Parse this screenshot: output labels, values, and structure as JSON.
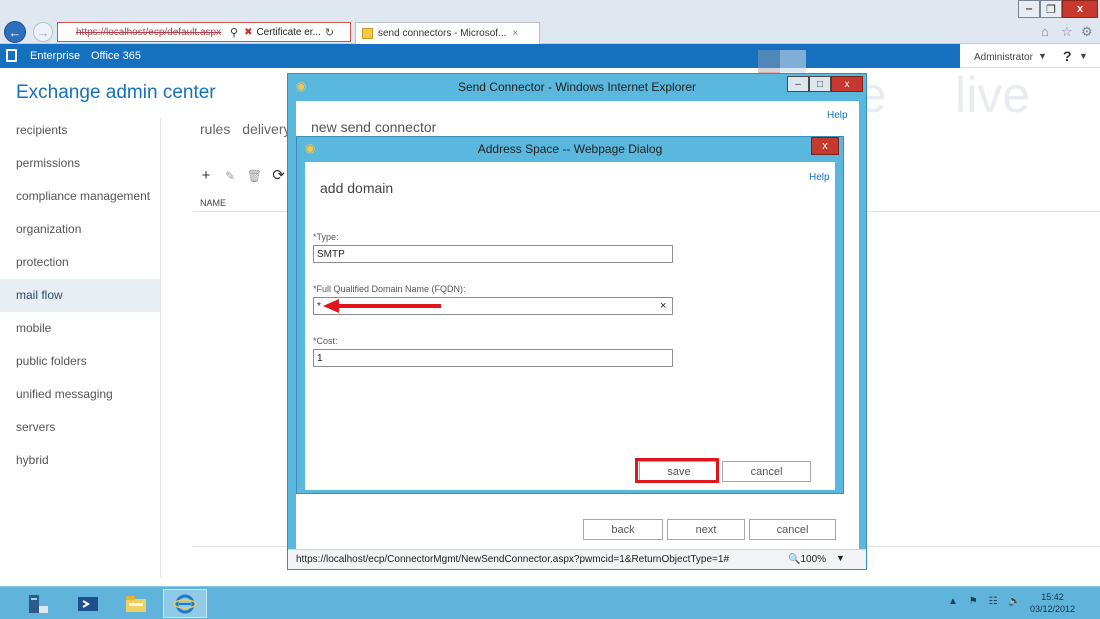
{
  "browser": {
    "address_url": "https://localhost/ecp/default.aspx",
    "cert_error": "Certificate er...",
    "tab_title": "send connectors - Microsof...",
    "tab_close": "×"
  },
  "topbar": {
    "nav_enterprise": "Enterprise",
    "nav_office365": "Office 365",
    "admin_name": "Administrator",
    "admin_caret": "▼",
    "help": "?",
    "help_caret": "▼"
  },
  "app_title": "Exchange admin center",
  "sidebar": {
    "items": [
      {
        "label": "recipients"
      },
      {
        "label": "permissions"
      },
      {
        "label": "compliance management"
      },
      {
        "label": "organization"
      },
      {
        "label": "protection"
      },
      {
        "label": "mail flow"
      },
      {
        "label": "mobile"
      },
      {
        "label": "public folders"
      },
      {
        "label": "unified messaging"
      },
      {
        "label": "servers"
      },
      {
        "label": "hybrid"
      }
    ],
    "active": "mail flow"
  },
  "subtabs": [
    "rules",
    "delivery"
  ],
  "toolbar": {
    "add": "+",
    "edit": "✎",
    "delete": "🗑",
    "refresh": "⟳"
  },
  "list": {
    "column_name": "NAME"
  },
  "brand": {
    "word1": "pete",
    "word2": "live"
  },
  "send_connector": {
    "window_title": "Send Connector - Windows Internet Explorer",
    "heading": "new send connector",
    "help": "Help",
    "back": "back",
    "next": "next",
    "cancel": "cancel",
    "status_url": "https://localhost/ecp/ConnectorMgmt/NewSendConnector.aspx?pwmcid=1&ReturnObjectType=1#",
    "zoom": "100%",
    "zoom_caret": "▼",
    "min": "‒",
    "max": "□",
    "close": "x"
  },
  "address_space": {
    "title": "Address Space -- Webpage Dialog",
    "close": "x",
    "heading": "add domain",
    "help": "Help",
    "type_label": "*Type:",
    "type_value": "SMTP",
    "fqdn_label": "*Full Qualified Domain Name (FQDN):",
    "fqdn_value": "*",
    "fqdn_clear": "×",
    "cost_label": "*Cost:",
    "cost_value": "1",
    "save": "save",
    "cancel": "cancel"
  },
  "taskbar": {
    "time": "15:42",
    "date": "03/12/2012"
  },
  "colors": {
    "accent": "#1570bf",
    "dialog_frame": "#5ab7de",
    "highlight": "#e0161c",
    "taskbar": "#60b4dc"
  }
}
